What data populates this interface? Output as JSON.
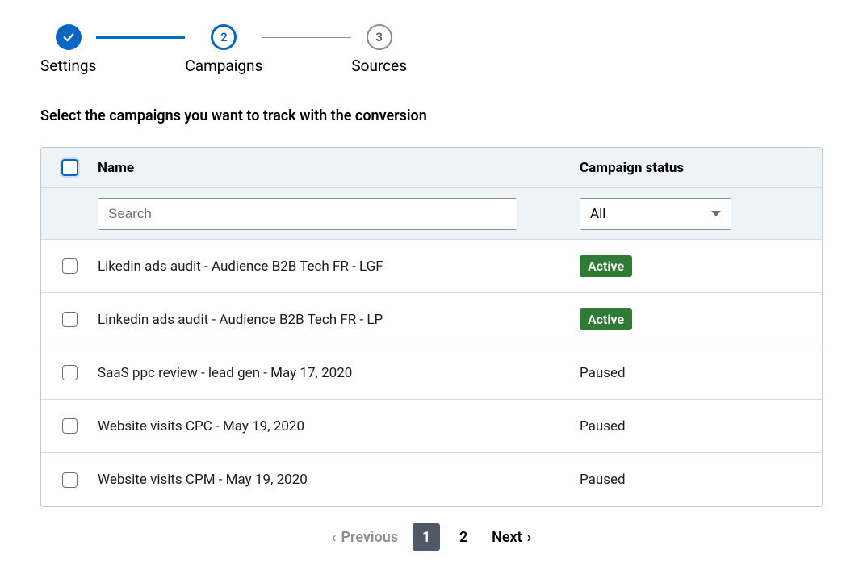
{
  "stepper": {
    "steps": [
      {
        "label": "Settings",
        "state": "done"
      },
      {
        "label": "Campaigns",
        "state": "current",
        "num": "2"
      },
      {
        "label": "Sources",
        "state": "upcoming",
        "num": "3"
      }
    ]
  },
  "instruction": "Select the campaigns you want to track with the conversion",
  "table": {
    "headers": {
      "name": "Name",
      "status": "Campaign status"
    },
    "search_placeholder": "Search",
    "status_filter_value": "All",
    "rows": [
      {
        "name": "Likedin ads audit - Audience B2B Tech FR - LGF",
        "status": "Active",
        "status_style": "active"
      },
      {
        "name": "Linkedin ads audit - Audience B2B Tech FR - LP",
        "status": "Active",
        "status_style": "active"
      },
      {
        "name": "SaaS ppc review - lead gen - May 17, 2020",
        "status": "Paused",
        "status_style": "text"
      },
      {
        "name": "Website visits CPC - May 19, 2020",
        "status": "Paused",
        "status_style": "text"
      },
      {
        "name": "Website visits CPM - May 19, 2020",
        "status": "Paused",
        "status_style": "text"
      }
    ]
  },
  "pagination": {
    "previous": "Previous",
    "next": "Next",
    "pages": [
      "1",
      "2"
    ],
    "current": "1"
  }
}
